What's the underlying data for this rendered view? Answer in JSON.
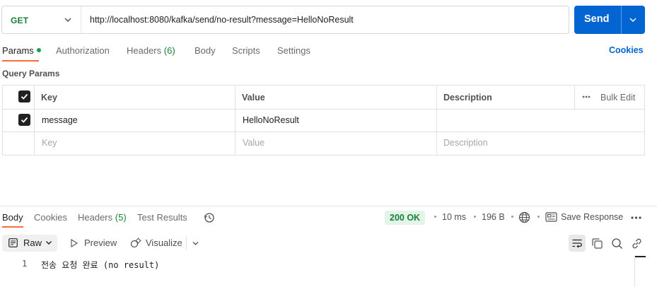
{
  "request": {
    "method": "GET",
    "url": "http://localhost:8080/kafka/send/no-result?message=HelloNoResult",
    "send_label": "Send"
  },
  "request_tabs": {
    "params": "Params",
    "authorization": "Authorization",
    "headers": "Headers",
    "headers_count": "(6)",
    "body": "Body",
    "scripts": "Scripts",
    "settings": "Settings",
    "cookies": "Cookies"
  },
  "query_params": {
    "title": "Query Params",
    "columns": {
      "key": "Key",
      "value": "Value",
      "description": "Description"
    },
    "bulk_edit": "Bulk Edit",
    "rows": [
      {
        "checked": true,
        "key": "message",
        "value": "HelloNoResult",
        "description": ""
      }
    ],
    "placeholders": {
      "key": "Key",
      "value": "Value",
      "description": "Description"
    }
  },
  "response_tabs": {
    "body": "Body",
    "cookies": "Cookies",
    "headers": "Headers",
    "headers_count": "(5)",
    "test_results": "Test Results"
  },
  "response_meta": {
    "status": "200 OK",
    "time": "10 ms",
    "size": "196 B",
    "save_response": "Save Response"
  },
  "body_toolbar": {
    "format": "Raw",
    "preview": "Preview",
    "visualize": "Visualize"
  },
  "response_body": {
    "lines": [
      {
        "number": "1",
        "text": "전송 요청 완료 (no result)"
      }
    ]
  },
  "colors": {
    "accent": "#ff6c37",
    "send_button": "#0265d2",
    "status_ok": "#1a7f37",
    "status_bg": "#e3f4e8"
  },
  "icons": [
    "chevron-down-icon",
    "check-icon",
    "bulk-edit-icon",
    "history-icon",
    "globe-icon",
    "save-icon",
    "more-icon",
    "raw-format-icon",
    "play-icon",
    "visualize-icon",
    "wrap-lines-icon",
    "copy-icon",
    "search-icon",
    "link-icon"
  ]
}
